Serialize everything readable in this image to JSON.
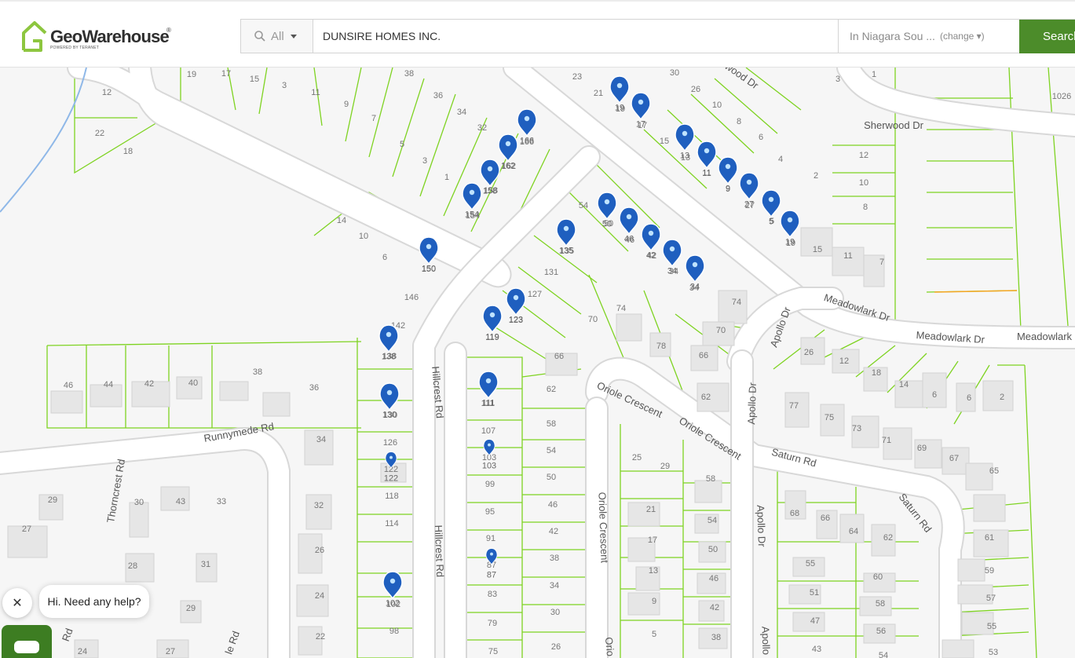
{
  "header": {
    "logo_text": "GeoWarehouse",
    "logo_mark": "®",
    "logo_sub": "POWERED BY TERANET",
    "search_scope": "All",
    "search_query": "DUNSIRE HOMES INC.",
    "region": "In Niagara Sou ...",
    "change_label": "(change ▾)",
    "search_button": "Search"
  },
  "icons": {
    "search": "search-icon",
    "scope_caret": "chevron-down-icon",
    "marker": "map-marker-icon",
    "close": "close-icon",
    "chat": "chat-icon"
  },
  "colors": {
    "brand_green": "#4c8c2a",
    "parcel_line": "#7ed321",
    "marker_blue": "#1f5fbf",
    "road_fill": "#ffffff",
    "water_line": "#8fb8e8"
  },
  "streets": [
    {
      "name": "Sherwood Dr"
    },
    {
      "name": "wood Dr"
    },
    {
      "name": "Meadowlark Dr"
    },
    {
      "name": "Meadowlark Dr"
    },
    {
      "name": "Meadowlark"
    },
    {
      "name": "Apollo Dr"
    },
    {
      "name": "Apollo Dr"
    },
    {
      "name": "Apollo Dr"
    },
    {
      "name": "Apollo"
    },
    {
      "name": "Oriole Crescent"
    },
    {
      "name": "Oriole Crescent"
    },
    {
      "name": "Oriole Crescent"
    },
    {
      "name": "Orio"
    },
    {
      "name": "Saturn Rd"
    },
    {
      "name": "Saturn Rd"
    },
    {
      "name": "Hillcrest Rd"
    },
    {
      "name": "Hillcrest Rd"
    },
    {
      "name": "Runnymede Rd"
    },
    {
      "name": "Thorncrest Rd"
    },
    {
      "name": "le Rd"
    },
    {
      "name": "Rd"
    },
    {
      "name": "es"
    }
  ],
  "lot_numbers": [
    "19",
    "17",
    "15",
    "3",
    "11",
    "9",
    "7",
    "5",
    "3",
    "1",
    "38",
    "36",
    "34",
    "32",
    "12",
    "22",
    "18",
    "14",
    "10",
    "6",
    "23",
    "21",
    "19",
    "17",
    "30",
    "26",
    "15",
    "13",
    "11",
    "10",
    "8",
    "6",
    "4",
    "2",
    "9",
    "27",
    "5",
    "19",
    "3",
    "1",
    "1026",
    "12",
    "10",
    "8",
    "54",
    "50",
    "46",
    "42",
    "34",
    "34",
    "15",
    "11",
    "7",
    "135",
    "131",
    "127",
    "123",
    "119",
    "146",
    "142",
    "138",
    "130",
    "126",
    "122",
    "118",
    "114",
    "102",
    "98",
    "162",
    "158",
    "154",
    "150",
    "166",
    "74",
    "74",
    "70",
    "70",
    "78",
    "66",
    "66",
    "62",
    "62",
    "58",
    "54",
    "50",
    "46",
    "42",
    "38",
    "34",
    "30",
    "26",
    "111",
    "107",
    "103",
    "99",
    "95",
    "91",
    "87",
    "83",
    "79",
    "75",
    "46",
    "44",
    "42",
    "40",
    "38",
    "36",
    "34",
    "32",
    "26",
    "24",
    "22",
    "30",
    "43",
    "33",
    "29",
    "27",
    "28",
    "31",
    "29",
    "24",
    "27",
    "26",
    "12",
    "18",
    "14",
    "6",
    "6",
    "2",
    "77",
    "75",
    "73",
    "71",
    "69",
    "67",
    "65",
    "68",
    "66",
    "64",
    "62",
    "61",
    "59",
    "57",
    "55",
    "53",
    "55",
    "51",
    "47",
    "43",
    "60",
    "58",
    "56",
    "54",
    "25",
    "29",
    "21",
    "17",
    "13",
    "9",
    "5",
    "58",
    "54",
    "50",
    "46",
    "42",
    "38"
  ],
  "markers": [
    "19",
    "17",
    "13",
    "11",
    "9",
    "27",
    "5",
    "19",
    "166",
    "162",
    "158",
    "154",
    "150",
    "50",
    "46",
    "42",
    "34",
    "34",
    "135",
    "123",
    "119",
    "138",
    "130",
    "122",
    "111",
    "103",
    "87",
    "102"
  ],
  "chat": {
    "message": "Hi. Need any help?"
  }
}
